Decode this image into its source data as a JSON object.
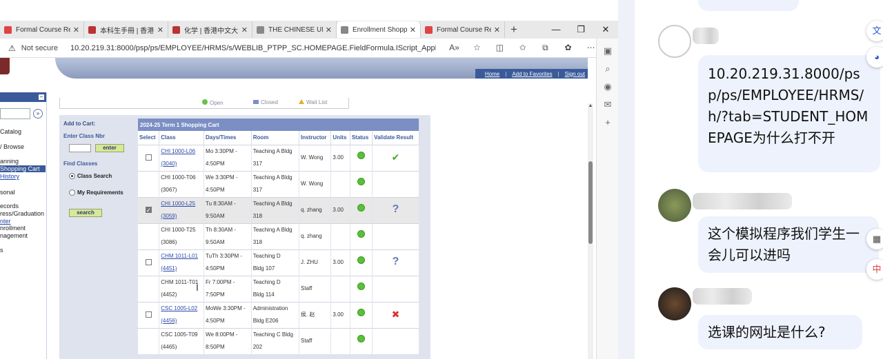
{
  "browser": {
    "tabs": [
      {
        "title": "Formal Course Re",
        "fav": "#d44"
      },
      {
        "title": "本科生手冊 | 香港",
        "fav": "#b33"
      },
      {
        "title": "化学 | 香港中文大",
        "fav": "#b33"
      },
      {
        "title": "THE CHINESE UNI",
        "fav": "#888"
      },
      {
        "title": "Enrollment Shopp",
        "fav": "#888"
      },
      {
        "title": "Formal Course Re",
        "fav": "#d44"
      }
    ],
    "not_secure": "Not secure",
    "url": "10.20.219.31:8000/psp/ps/EMPLOYEE/HRMS/s/WEBLIB_PTPP_SC.HOMEPAGE.FieldFormula.IScript_AppHP?pt_fn..."
  },
  "header": {
    "home": "Home",
    "add_favorites": "Add to Favorites",
    "sign_out": "Sign out"
  },
  "leftnav": {
    "items": [
      "Catalog",
      "/ Browse",
      "anning",
      "Shopping Cart",
      "History",
      "sonal",
      "ecords",
      "ress/Graduation",
      "nter",
      "nrollment",
      "nagement",
      "s"
    ]
  },
  "legend": {
    "open": "Open",
    "closed": "Closed",
    "wait_list": "Wait List"
  },
  "cart": {
    "add_to_cart": "Add to Cart:",
    "enter_class_nbr": "Enter Class Nbr",
    "enter_btn": "enter",
    "find_classes": "Find Classes",
    "class_search": "Class Search",
    "my_requirements": "My Requirements",
    "search_btn": "search",
    "caption": "2024-25 Term 1 Shopping Cart",
    "columns": [
      "Select",
      "Class",
      "Days/Times",
      "Room",
      "Instructor",
      "Units",
      "Status",
      "Validate Result"
    ],
    "rows": [
      {
        "select": "box",
        "class1": "CHI 1000-L06",
        "class2": "(3040)",
        "link": true,
        "days1": "Mo 3:30PM -",
        "days2": "4:50PM",
        "room1": "Teaching A Bldg",
        "room2": "317",
        "instructor": "W. Wong",
        "units": "3.00",
        "validate": "check",
        "hl": false
      },
      {
        "select": "",
        "class1": "CHI 1000-T06",
        "class2": "(3067)",
        "link": false,
        "days1": "We 3:30PM -",
        "days2": "4:50PM",
        "room1": "Teaching A Bldg",
        "room2": "317",
        "instructor": "W. Wong",
        "units": "",
        "validate": "",
        "hl": false
      },
      {
        "select": "checked",
        "class1": "CHI 1000-L25",
        "class2": "(3059)",
        "link": true,
        "days1": "Tu 8:30AM -",
        "days2": "9:50AM",
        "room1": "Teaching A Bldg",
        "room2": "318",
        "instructor": "q. zhang",
        "units": "3.00",
        "validate": "question",
        "hl": true
      },
      {
        "select": "",
        "class1": "CHI 1000-T25",
        "class2": "(3086)",
        "link": false,
        "days1": "Th 8:30AM -",
        "days2": "9:50AM",
        "room1": "Teaching A Bldg",
        "room2": "318",
        "instructor": "q. zhang",
        "units": "",
        "validate": "",
        "hl": false
      },
      {
        "select": "box",
        "class1": "CHM 1011-L01",
        "class2": "(4451)",
        "link": true,
        "days1": "TuTh 3:30PM -",
        "days2": "4:50PM",
        "room1": "Teaching D",
        "room2": "Bldg 107",
        "instructor": "J. ZHU",
        "units": "3.00",
        "validate": "question",
        "hl": false
      },
      {
        "select": "",
        "class1": "CHM 1011-T01",
        "class2": "(4452)",
        "link": false,
        "days1": "Fr 7:00PM -",
        "days2": "7:50PM",
        "room1": "Teaching D",
        "room2": "Bldg 114",
        "instructor": "Staff",
        "units": "",
        "validate": "",
        "hl": false
      },
      {
        "select": "box",
        "class1": "CSC 1005-L02",
        "class2": "(4456)",
        "link": true,
        "days1": "MoWe 3:30PM -",
        "days2": "4:50PM",
        "room1": "Administration",
        "room2": "Bldg E206",
        "instructor": "侯. 赵",
        "units": "3.00",
        "validate": "cross",
        "hl": false
      },
      {
        "select": "",
        "class1": "CSC 1005-T09",
        "class2": "(4465)",
        "link": false,
        "days1": "We 8:00PM -",
        "days2": "8:50PM",
        "room1": "Teaching C Bldg",
        "room2": "202",
        "instructor": "Staff",
        "units": "",
        "validate": "",
        "hl": false
      }
    ]
  },
  "chat": {
    "msg1": "10.20.219.31.8000/psp/ps/EMPLOYEE/HRMS/h/?tab=STUDENT_HOMEPAGE为什么打不开",
    "msg2": "这个模拟程序我们学生一会儿可以进吗",
    "msg3": "选课的网址是什么?"
  },
  "colors": {
    "accent": "#3a5a9a",
    "grid_header": "#7b8fc4",
    "bubble": "#eef2fc"
  }
}
